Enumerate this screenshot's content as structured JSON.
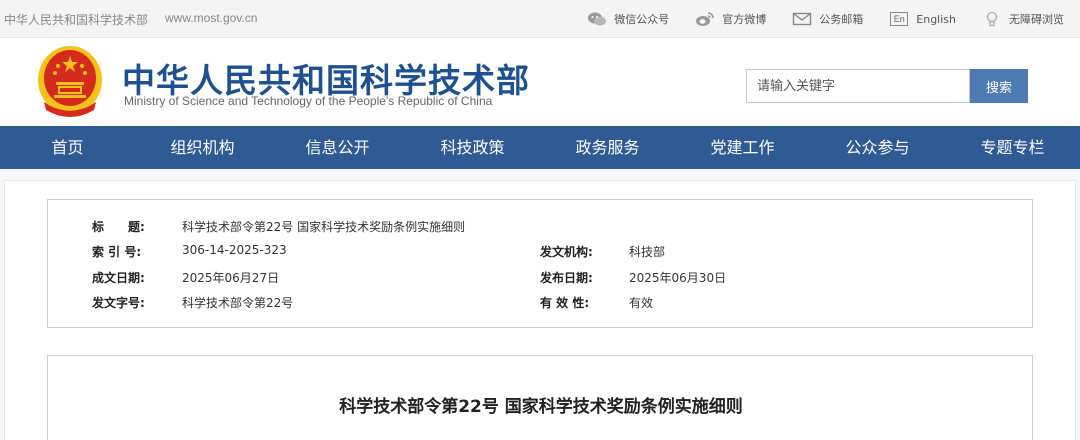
{
  "topbar": {
    "site_name": "中华人民共和国科学技术部",
    "site_url": "www.most.gov.cn",
    "tools": [
      {
        "label": "微信公众号",
        "icon": "wechat-icon"
      },
      {
        "label": "官方微博",
        "icon": "weibo-icon"
      },
      {
        "label": "公务邮箱",
        "icon": "mail-icon"
      },
      {
        "label": "English",
        "icon": "english-icon",
        "icon_text": "En"
      },
      {
        "label": "无障碍浏览",
        "icon": "accessibility-icon"
      }
    ]
  },
  "header": {
    "title_cn": "中华人民共和国科学技术部",
    "title_en": "Ministry of Science and Technology of the People's Republic of China",
    "emblem": "national-emblem",
    "search_placeholder": "请输入关键字",
    "search_button": "搜索"
  },
  "nav": {
    "items": [
      "首页",
      "组织机构",
      "信息公开",
      "科技政策",
      "政务服务",
      "党建工作",
      "公众参与",
      "专题专栏"
    ]
  },
  "meta": {
    "title_label": "标　　题:",
    "title_value": "科学技术部令第22号 国家科学技术奖励条例实施细则",
    "index_label": "索 引 号:",
    "index_value": "306-14-2025-323",
    "issuer_label": "发文机构:",
    "issuer_value": "科技部",
    "created_label": "成文日期:",
    "created_value": "2025年06月27日",
    "published_label": "发布日期:",
    "published_value": "2025年06月30日",
    "docno_label": "发文字号:",
    "docno_value": "科学技术部令第22号",
    "validity_label": "有 效 性:",
    "validity_value": "有效"
  },
  "article": {
    "title": "科学技术部令第22号 国家科学技术奖励条例实施细则"
  },
  "colors": {
    "brand_blue": "#1f5190",
    "nav_bg": "#2f5a94",
    "search_button": "#4f7bb5",
    "emblem_red": "#d52b1e",
    "emblem_gold": "#f5c21b"
  }
}
